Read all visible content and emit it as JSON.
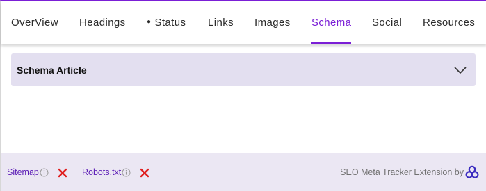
{
  "tabs": [
    {
      "label": "OverView"
    },
    {
      "label": "Headings"
    },
    {
      "label": "Status",
      "indicator": "●"
    },
    {
      "label": "Links"
    },
    {
      "label": "Images"
    },
    {
      "label": "Schema",
      "active": true
    },
    {
      "label": "Social"
    },
    {
      "label": "Resources"
    }
  ],
  "accordion": {
    "title": "Schema Article",
    "icon": "chevron-down-icon"
  },
  "footer": {
    "sitemap_label": "Sitemap",
    "robots_label": "Robots.txt",
    "sitemap_status": "missing",
    "robots_status": "missing",
    "credit_text": "SEO Meta Tracker Extension by",
    "status_color": "#e02020",
    "accent_color": "#7b1fd6"
  }
}
